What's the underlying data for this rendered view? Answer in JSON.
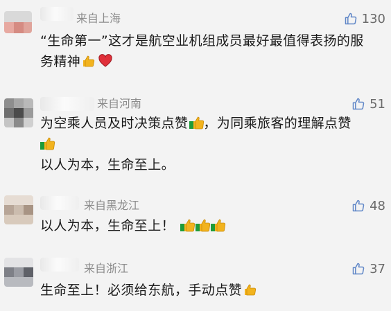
{
  "comments": [
    {
      "location": "来自上海",
      "likes": "130",
      "lines": [
        "“生命第一”这才是航空业机组成员最好最值得表扬的服",
        "务精神"
      ],
      "end_emojis": [
        "thumbs-up",
        "red-heart"
      ]
    },
    {
      "location": "来自河南",
      "likes": "51",
      "lines": [
        "为空乘人员及时决策点赞",
        "，为同乘旅客的理解点赞",
        "以人为本，生命至上。"
      ]
    },
    {
      "location": "来自黑龙江",
      "likes": "48",
      "lines": [
        "以人为本，生命至上！"
      ]
    },
    {
      "location": "来自浙江",
      "likes": "37",
      "lines": [
        "生命至上！必须给东航，手动点赞"
      ]
    }
  ],
  "icons": {
    "like": "thumbs-up-outline-icon",
    "emoji_thumb": "thumbs-up-emoji",
    "emoji_heart": "red-heart-emoji"
  },
  "colors": {
    "background": "#f3f3f3",
    "text": "#1a1a1a",
    "meta": "#8c8c8c",
    "like_icon": "#5f86c7",
    "heart": "#e0303a",
    "thumb": "#f2b31e"
  }
}
